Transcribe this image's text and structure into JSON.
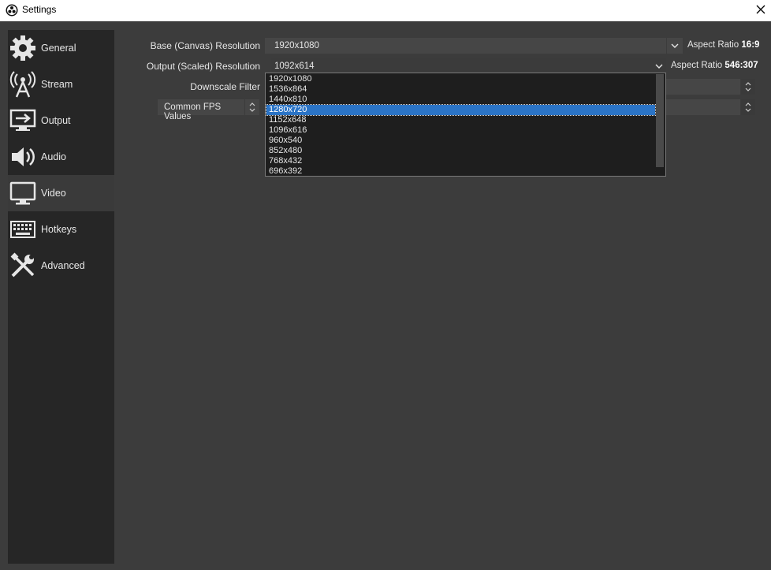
{
  "window": {
    "title": "Settings"
  },
  "sidebar": {
    "items": [
      {
        "label": "General",
        "icon": "gear-icon"
      },
      {
        "label": "Stream",
        "icon": "antenna-icon"
      },
      {
        "label": "Output",
        "icon": "output-icon"
      },
      {
        "label": "Audio",
        "icon": "speaker-icon"
      },
      {
        "label": "Video",
        "icon": "monitor-icon",
        "active": true
      },
      {
        "label": "Hotkeys",
        "icon": "keyboard-icon"
      },
      {
        "label": "Advanced",
        "icon": "tools-icon"
      }
    ]
  },
  "video": {
    "base_label": "Base (Canvas) Resolution",
    "base_value": "1920x1080",
    "base_aspect_label": "Aspect Ratio",
    "base_aspect_value": "16:9",
    "output_label": "Output (Scaled) Resolution",
    "output_value": "1092x614",
    "output_aspect_label": "Aspect Ratio",
    "output_aspect_value": "546:307",
    "downscale_label": "Downscale Filter",
    "fps_label": "Common FPS Values"
  },
  "dropdown": {
    "options": [
      "1920x1080",
      "1536x864",
      "1440x810",
      "1280x720",
      "1152x648",
      "1096x616",
      "960x540",
      "852x480",
      "768x432",
      "696x392"
    ],
    "selected": "1280x720"
  }
}
